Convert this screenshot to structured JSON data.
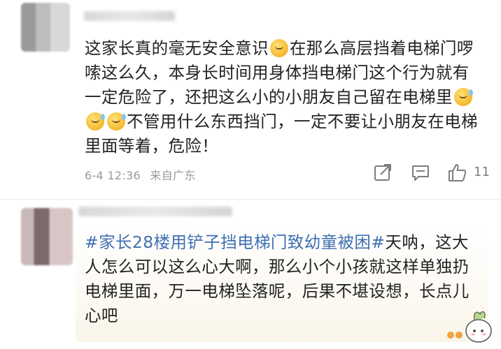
{
  "comments": [
    {
      "text_parts": [
        "这家长真的毫无安全意识",
        "在那么高层挡着电梯门啰嗦这么久，本身长时间用身体挡电梯门这个行为就有一定危险了，还把这么小的小朋友自己留在电梯里",
        "不管用什么东西挡门，一定不要让小朋友在电梯里面等着，危险！"
      ],
      "timestamp": "6-4 12:36",
      "location": "来自广东",
      "like_count": "11"
    },
    {
      "topic": "#家长28楼用铲子挡电梯门致幼童被困#",
      "text": "天呐，这大人怎么可以这么心大啊，那么小个小孩就这样单独扔电梯里面，万一电梯坠落呢，后果不堪设想，长点儿心吧"
    }
  ],
  "icons": {
    "share": "share-icon",
    "comment": "comment-icon",
    "like": "thumbs-up-icon"
  },
  "colors": {
    "topic": "#3f6fb0",
    "meta": "#9a9a9a"
  }
}
